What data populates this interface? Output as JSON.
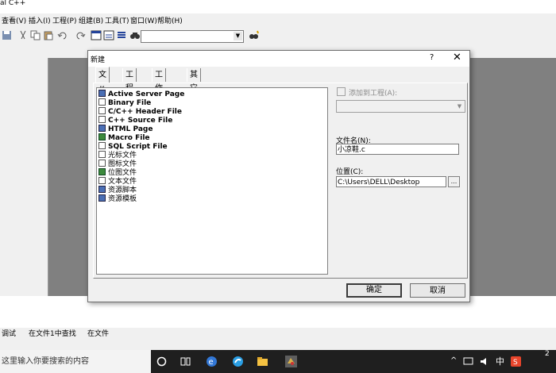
{
  "app": {
    "title": "al C++"
  },
  "menu": [
    "查看(V)",
    "插入(I)",
    "工程(P)",
    "组建(B)",
    "工具(T)",
    "窗口(W)",
    "帮助(H)"
  ],
  "dialog": {
    "title": "新建",
    "help": "?",
    "close": "✕",
    "tabs": [
      "文件",
      "工程",
      "工作区",
      "其它文档"
    ],
    "file_types": [
      {
        "label": "Active Server Page",
        "icon": "asp-icon",
        "bold": true
      },
      {
        "label": "Binary File",
        "icon": "binary-file-icon",
        "bold": true
      },
      {
        "label": "C/C++ Header File",
        "icon": "header-file-icon",
        "bold": true
      },
      {
        "label": "C++ Source File",
        "icon": "source-file-icon",
        "bold": true
      },
      {
        "label": "HTML Page",
        "icon": "html-page-icon",
        "bold": true
      },
      {
        "label": "Macro File",
        "icon": "macro-file-icon",
        "bold": true
      },
      {
        "label": "SQL Script File",
        "icon": "sql-file-icon",
        "bold": true
      },
      {
        "label": "光标文件",
        "icon": "cursor-file-icon",
        "bold": false
      },
      {
        "label": "图标文件",
        "icon": "icon-file-icon",
        "bold": false
      },
      {
        "label": "位图文件",
        "icon": "bitmap-file-icon",
        "bold": false
      },
      {
        "label": "文本文件",
        "icon": "text-file-icon",
        "bold": false
      },
      {
        "label": "资源脚本",
        "icon": "resource-script-icon",
        "bold": false
      },
      {
        "label": "资源模板",
        "icon": "resource-template-icon",
        "bold": false
      }
    ],
    "add_to_project_label": "添加到工程(A):",
    "filename_label": "文件名(N):",
    "filename_value": "小凉鞋.c",
    "location_label": "位置(C):",
    "location_value": "C:\\Users\\DELL\\Desktop",
    "browse_label": "...",
    "ok_label": "确定",
    "cancel_label": "取消"
  },
  "output_tabs": [
    "调试",
    "在文件1中查找",
    "在文件"
  ],
  "taskbar": {
    "search_placeholder": "这里输入你要搜索的内容",
    "clock": "2"
  },
  "colors": {
    "dialog_bg": "#f0f0f0",
    "workspace": "#808080",
    "taskbar": "#1f1f1f"
  }
}
